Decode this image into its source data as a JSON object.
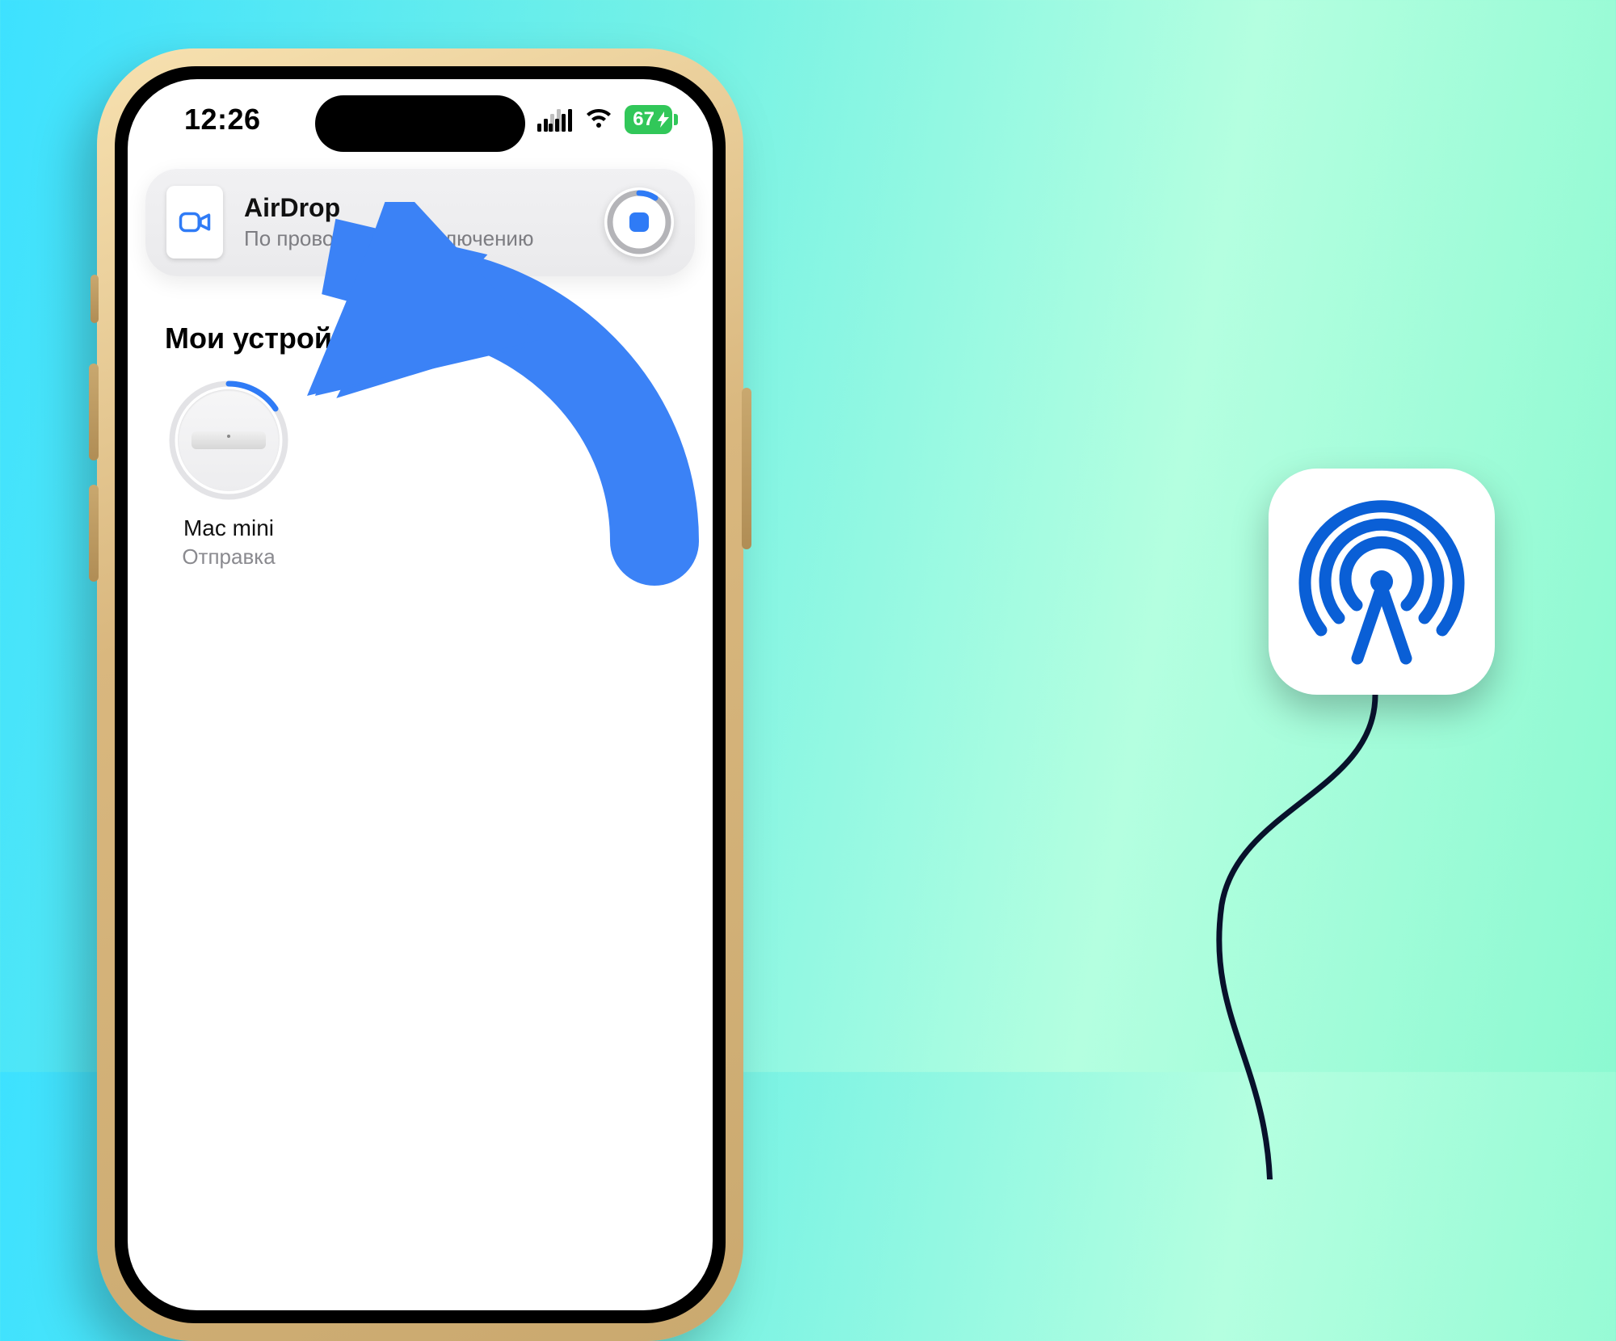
{
  "status_bar": {
    "time": "12:26",
    "battery_percent": "67"
  },
  "banner": {
    "title": "AirDrop",
    "subtitle": "По проводному подключению"
  },
  "section": {
    "title": "Мои устройства"
  },
  "device": {
    "name": "Mac mini",
    "status": "Отправка"
  },
  "colors": {
    "accent_blue": "#3b82f6",
    "battery_green": "#31c759"
  },
  "icons": {
    "file_thumb": "video-icon",
    "stop": "stop-icon",
    "signal": "dual-sim-signal-icon",
    "wifi": "wifi-icon",
    "airdrop": "airdrop-icon"
  }
}
